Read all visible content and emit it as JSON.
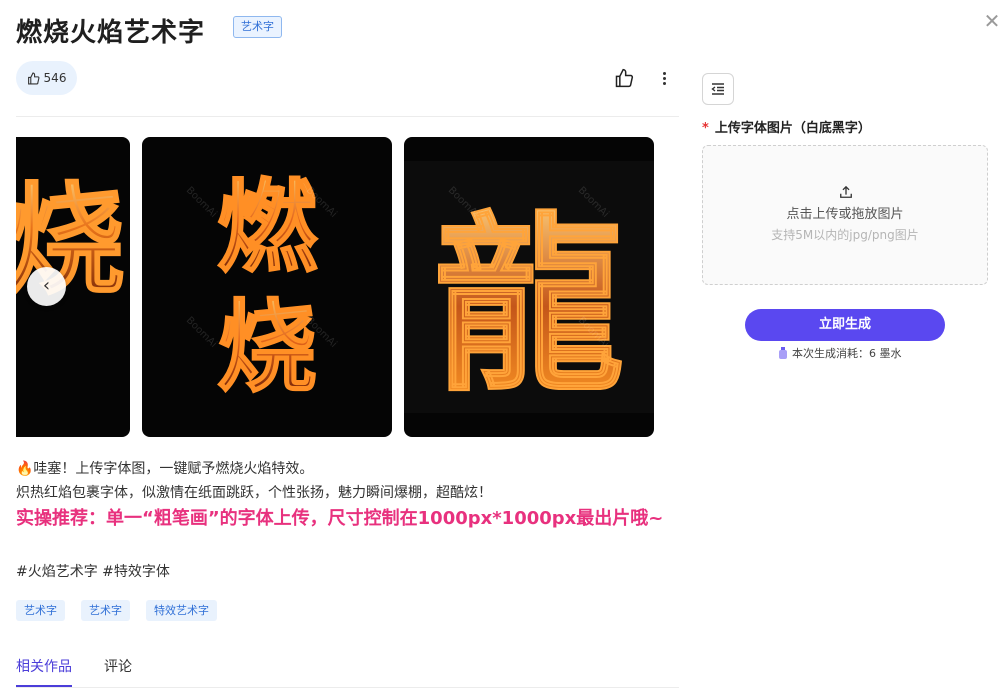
{
  "header": {
    "title": "燃烧火焰艺术字",
    "badge": "艺术字",
    "close_icon": "close-icon"
  },
  "actions": {
    "like_count": "546",
    "like_icon": "thumbs-up-icon",
    "more_icon": "more-vertical-icon"
  },
  "carousel": {
    "prev_icon": "chevron-left-icon",
    "watermark": "BoomAi",
    "slides": [
      {
        "chars": "燃烧"
      },
      {
        "chars": "燃烧"
      },
      {
        "chars": "龍"
      }
    ]
  },
  "description": {
    "line1": "🔥哇塞！上传字体图，一键赋予燃烧火焰特效。",
    "line2": "炽热红焰包裹字体，似激情在纸面跳跃，个性张扬，魅力瞬间爆棚，超酷炫！",
    "line3": "实操推荐：单一“粗笔画”的字体上传，尺寸控制在1000px*1000px最出片哦~",
    "line4": "#火焰艺术字 #特效字体"
  },
  "tags": [
    "艺术字",
    "艺术字",
    "特效艺术字"
  ],
  "tabs": [
    {
      "label": "相关作品",
      "active": true
    },
    {
      "label": "评论",
      "active": false
    }
  ],
  "panel": {
    "toggle_icon": "collapse-panel-icon",
    "upload_required_mark": "*",
    "upload_label": "上传字体图片（白底黑字）",
    "upload_icon": "upload-icon",
    "upload_main": "点击上传或拖放图片",
    "upload_sub": "支持5M以内的jpg/png图片",
    "generate_label": "立即生成",
    "cost_icon": "ink-bottle-icon",
    "cost_text": "本次生成消耗：6 墨水"
  },
  "colors": {
    "accent": "#5a48f0",
    "highlight_text": "#e8317e",
    "tag_bg": "#e9f2fd",
    "tag_text": "#2f6fd6"
  }
}
